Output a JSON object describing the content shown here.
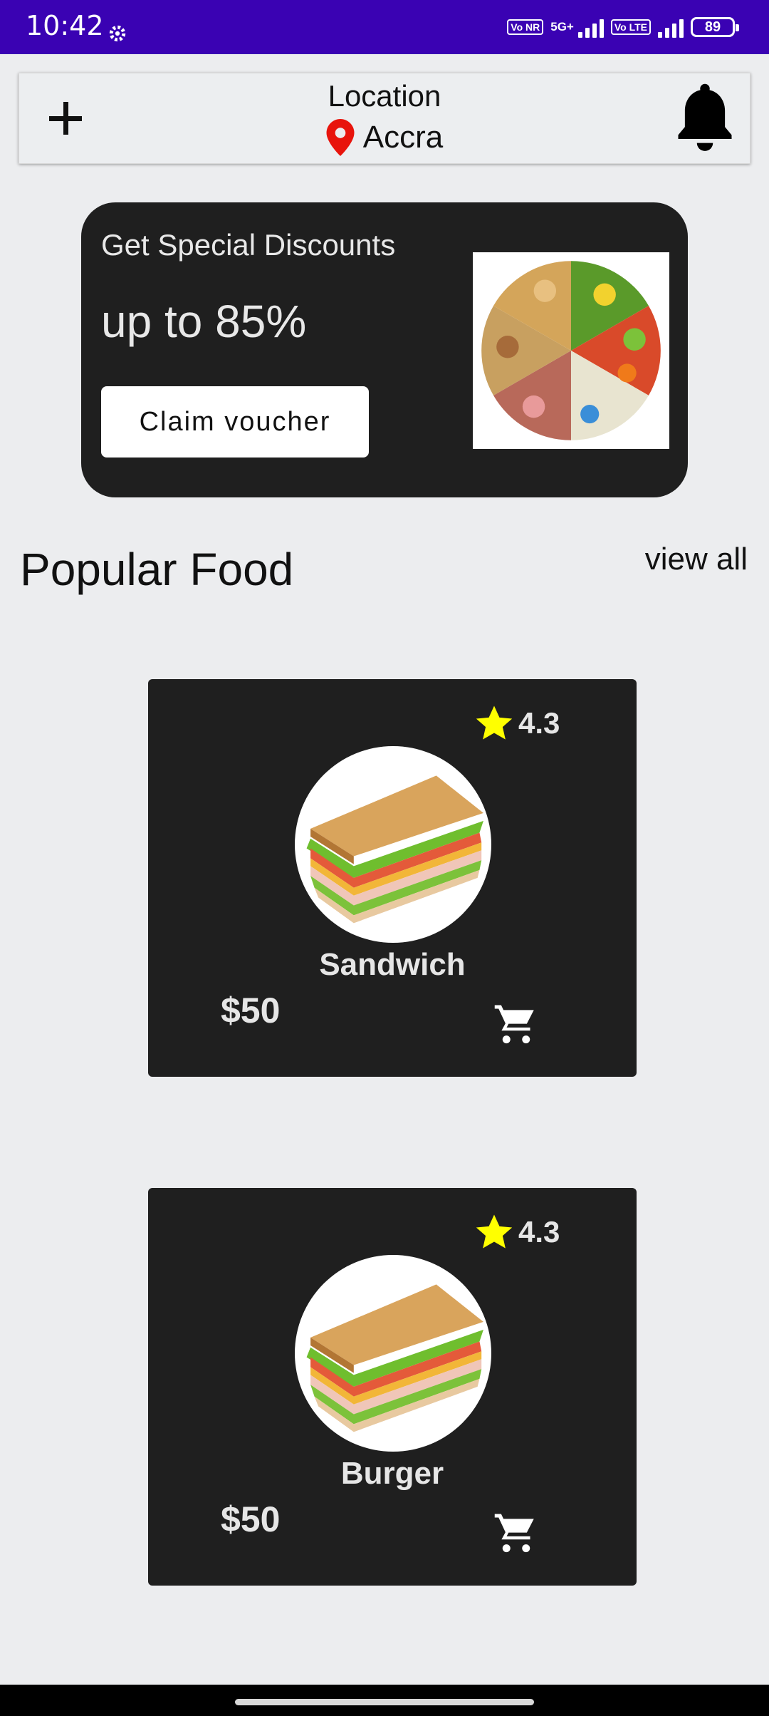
{
  "status_bar": {
    "time": "10:42",
    "tag1": "Vo NR",
    "network": "5G+",
    "tag2": "Vo LTE",
    "battery": "89"
  },
  "app_bar": {
    "add_icon": "plus-icon",
    "location_title": "Location",
    "location_icon": "map-pin-icon",
    "location_city": "Accra",
    "notification_icon": "bell-icon"
  },
  "promo": {
    "title": "Get Special Discounts",
    "discount": "up to 85%",
    "button_label": "Claim voucher"
  },
  "popular": {
    "title": "Popular Food",
    "view_all": "view all",
    "items": [
      {
        "name": "Sandwich",
        "rating": "4.3",
        "price": "$50"
      },
      {
        "name": "Burger",
        "rating": "4.3",
        "price": "$50"
      }
    ]
  },
  "colors": {
    "status_bar": "#3a02b3",
    "card_bg": "#1f1f1f",
    "star": "#ffff00",
    "pin": "#e8140c"
  }
}
